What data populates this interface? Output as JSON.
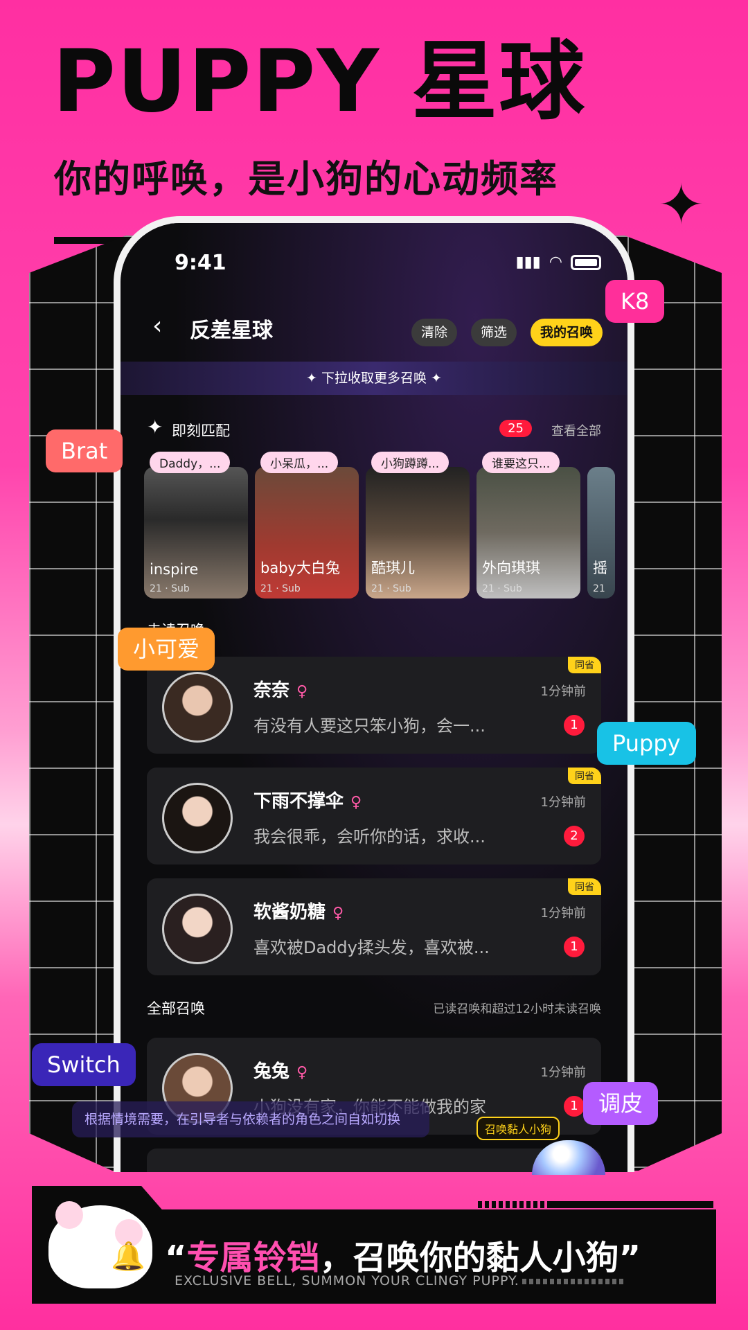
{
  "poster": {
    "headline": "PUPPY 星球",
    "subline": "你的呼唤，是小狗的心动频率"
  },
  "status_bar": {
    "time": "9:41"
  },
  "nav": {
    "title": "反差星球",
    "clear_label": "清除",
    "filter_label": "筛选",
    "my_summon_label": "我的召唤"
  },
  "pull_banner": "下拉收取更多召唤",
  "match": {
    "title": "即刻匹配",
    "count": "25",
    "see_all": "查看全部",
    "cards": [
      {
        "bubble": "Daddy，...",
        "name": "inspire",
        "meta": "21 · Sub"
      },
      {
        "bubble": "小呆瓜，...",
        "name": "baby大白兔",
        "meta": "21 · Sub"
      },
      {
        "bubble": "小狗蹲蹲...",
        "name": "酷琪儿",
        "meta": "21 · Sub"
      },
      {
        "bubble": "谁要这只...",
        "name": "外向琪琪",
        "meta": "21 · Sub"
      },
      {
        "bubble": "",
        "name": "摇",
        "meta": "21"
      }
    ]
  },
  "unread": {
    "title": "未读召唤",
    "messages": [
      {
        "name": "奈奈",
        "text": "有没有人要这只笨小狗，会一...",
        "time": "1分钟前",
        "count": "1",
        "tag": "同省"
      },
      {
        "name": "下雨不撑伞",
        "text": "我会很乖，会听你的话，求收...",
        "time": "1分钟前",
        "count": "2",
        "tag": "同省"
      },
      {
        "name": "软酱奶糖",
        "text": "喜欢被Daddy揉头发，喜欢被...",
        "time": "1分钟前",
        "count": "1",
        "tag": "同省"
      }
    ]
  },
  "all": {
    "title": "全部召唤",
    "note": "已读召唤和超过12小时未读召唤",
    "messages": [
      {
        "name": "兔兔",
        "text": "小狗没有家，你能不能做我的家",
        "time": "1分钟前",
        "count": "1"
      }
    ]
  },
  "summon_bubble": "召唤黏人小狗",
  "labels": {
    "k8": "K8",
    "brat": "Brat",
    "cute": "小可爱",
    "puppy": "Puppy",
    "switch": "Switch",
    "tiaopi": "调皮",
    "switch_tip": "根据情境需要，在引导者与依赖者的角色之间自如切换"
  },
  "footer": {
    "quote_open": "“",
    "quote_pink": "专属铃铛",
    "quote_rest": "，召唤你的黏人小狗”",
    "english": "EXCLUSIVE BELL, SUMMON YOUR CLINGY PUPPY."
  },
  "colors": {
    "brand_pink": "#ff2fa2",
    "accent_yellow": "#ffd21a",
    "badge_red": "#ff1b3c"
  },
  "icons": [
    "back-icon",
    "signal-icon",
    "wifi-icon",
    "battery-icon",
    "sparkle-icon",
    "female-icon",
    "bell-icon"
  ]
}
